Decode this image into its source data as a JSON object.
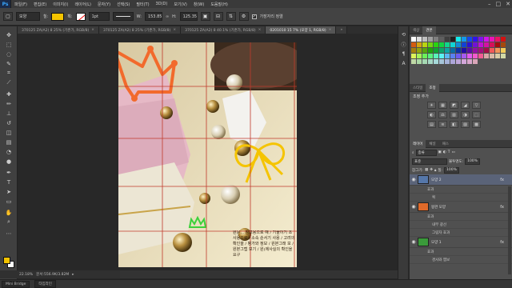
{
  "menubar": {
    "logo": "Ps",
    "items": [
      "파일(F)",
      "편집(E)",
      "이미지(I)",
      "레이어(L)",
      "문자(Y)",
      "선택(S)",
      "필터(T)",
      "3D(D)",
      "보기(V)",
      "창(W)",
      "도움말(H)"
    ],
    "window_controls": [
      "–",
      "□",
      "✕"
    ]
  },
  "options": {
    "tool_preset": "▢",
    "shape_mode": "모양",
    "fill_label": "칠:",
    "stroke_label": "획:",
    "stroke_width": "1pt",
    "width_label": "W:",
    "width_value": "153.85",
    "link_icon": "∞",
    "height_label": "H:",
    "height_value": "125.35",
    "align_edges": "가장자리 정렬",
    "align_checked": "✓"
  },
  "tabs": [
    {
      "label": "370125 ZA(A2) 8 25% (기존가, RGB/8)",
      "active": false
    },
    {
      "label": "370125 ZA(A2) 8 25% (기존가, RGB/8)",
      "active": false
    },
    {
      "label": "370125 ZA(A2) 8 40.1% (기존가, RGB/8)",
      "active": false
    },
    {
      "label": "0201010 15 7% (모양 1, RGB/8)",
      "active": true
    },
    {
      "label": "»",
      "active": false
    }
  ],
  "status": {
    "zoom": "22.18%",
    "doc_size": "문서:556.9K/3.82M",
    "nav_arrow": "▸"
  },
  "bottombar": {
    "tabs": [
      "Mini Bridge",
      "타임라인"
    ]
  },
  "right": {
    "swatch_tabs": [
      "색상",
      "견본"
    ],
    "adjust_tabs": [
      "스타일",
      "조정"
    ],
    "adjust_title": "조정 추가",
    "adjust_icons": [
      "☀",
      "▦",
      "◩",
      "◢",
      "▽",
      "◐",
      "⚖",
      "▥",
      "◑",
      "⬚",
      "▤",
      "≋",
      "◧",
      "▨",
      "▩"
    ],
    "layers_tabs": [
      "레이어",
      "채널",
      "패스"
    ],
    "kind_label": "종류",
    "blend_mode": "표준",
    "opacity_label": "불투명도:",
    "opacity": "100%",
    "lock_label": "잠그기:",
    "fill_label": "칠:",
    "fill": "100%",
    "layers": [
      {
        "name": "모양 2",
        "selected": true,
        "fx": "fx",
        "thumb": "#5577aa",
        "effects": [
          "효과",
          "획"
        ]
      },
      {
        "name": "왕관 모양",
        "selected": false,
        "fx": "fx",
        "thumb": "#e06a2a",
        "effects": [
          "효과",
          "내부 광선",
          "그림자 효과"
        ]
      },
      {
        "name": "모양 1",
        "selected": false,
        "fx": "fx",
        "thumb": "#3a9a3a",
        "effects": [
          "효과",
          "경사와 엠보"
        ]
      }
    ]
  },
  "canvas": {
    "korean_text": "원문... 참고용으로 예 / 기울이기 초 사용으로 / 소속 순서기 사용 / 고려의 확인을 / 평가와 정보 / 원본그래 보 / 원본그랩 보기 / 원(에사실의 확인을 요구"
  },
  "colors": {
    "accent_yellow": "#f5c400",
    "crown_orange": "#f26a2c",
    "crown_green": "#3bd13b",
    "guide_red": "#c0392b"
  }
}
